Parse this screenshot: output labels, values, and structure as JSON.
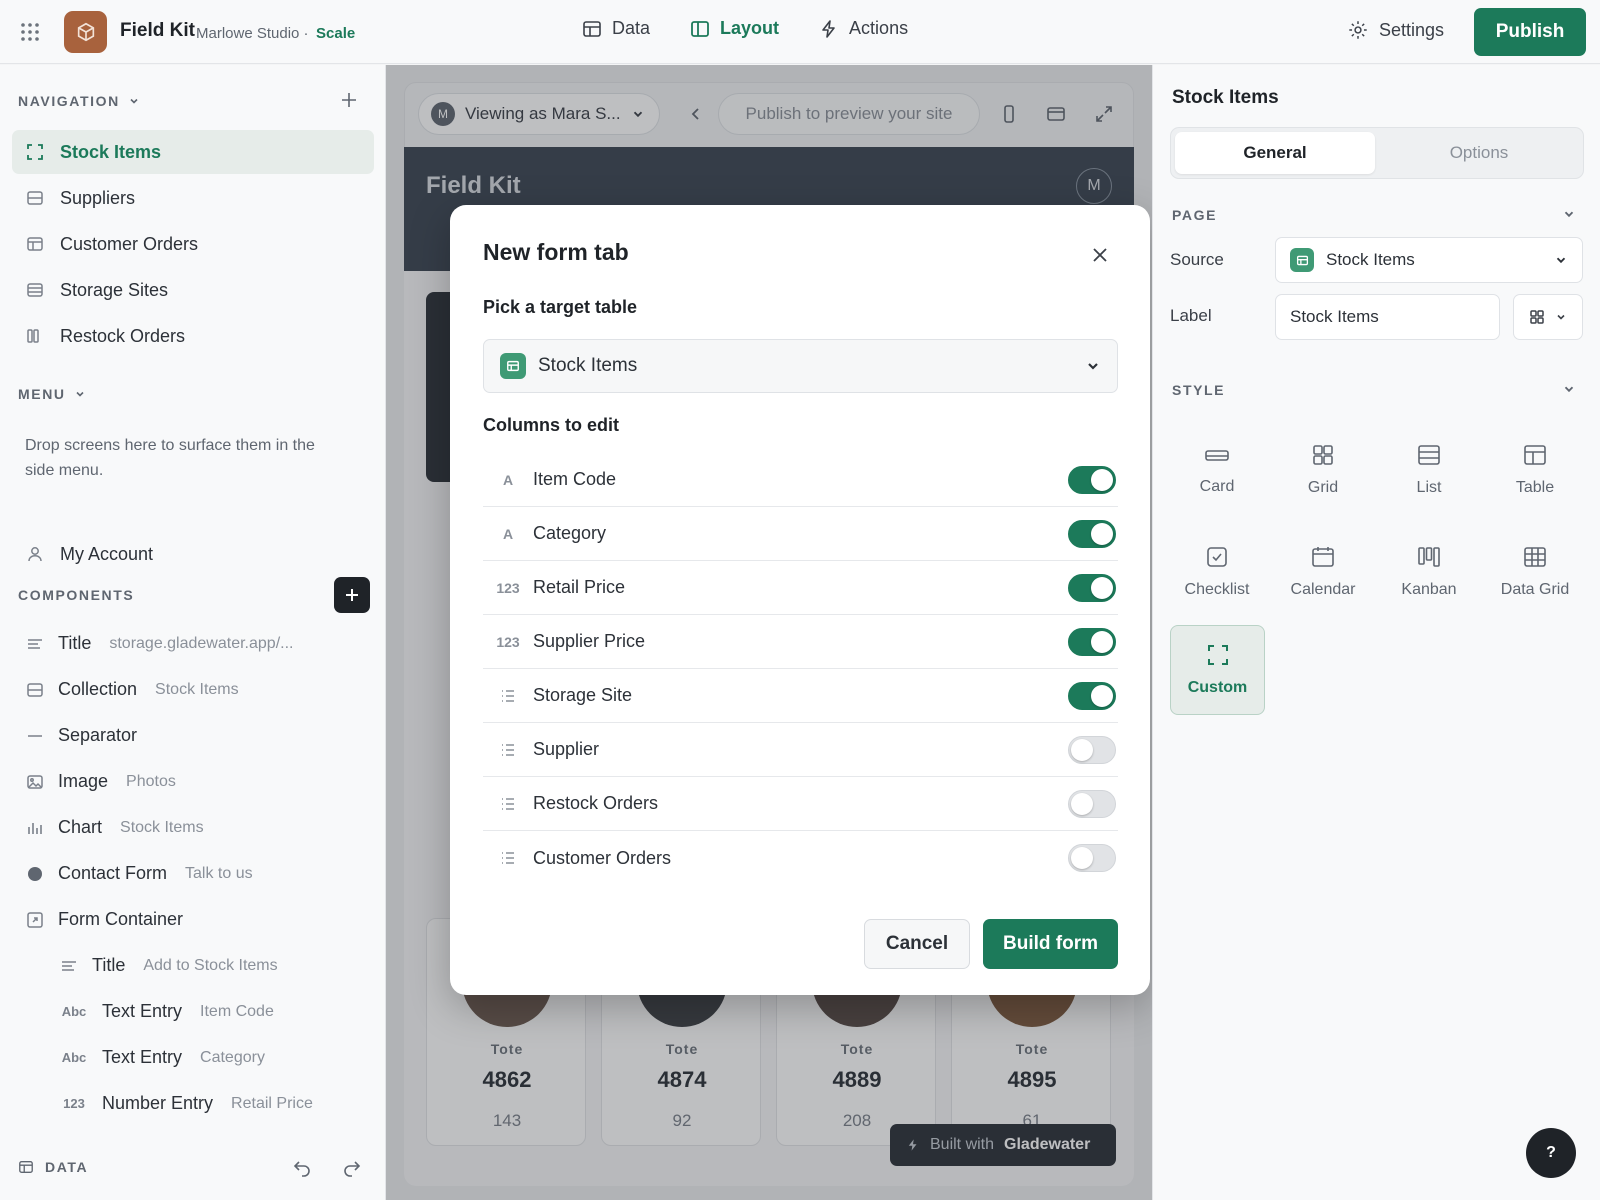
{
  "topbar": {
    "app_name": "Field Kit",
    "org_name": "Marlowe Studio ·",
    "plan": "Scale",
    "nav": [
      {
        "label": "Data",
        "icon": "table-icon"
      },
      {
        "label": "Layout",
        "icon": "layout-icon",
        "active": true
      },
      {
        "label": "Actions",
        "icon": "bolt-icon"
      }
    ],
    "settings_label": "Settings",
    "publish_label": "Publish"
  },
  "sidebar": {
    "navigation_heading": "NAVIGATION",
    "nav_items": [
      {
        "label": "Stock Items",
        "icon": "custom-screen-icon",
        "active": true
      },
      {
        "label": "Suppliers",
        "icon": "collection-icon"
      },
      {
        "label": "Customer Orders",
        "icon": "table-icon"
      },
      {
        "label": "Storage Sites",
        "icon": "list-icon"
      },
      {
        "label": "Restock Orders",
        "icon": "kanban-icon"
      }
    ],
    "menu_heading": "MENU",
    "menu_hint": "Drop screens here to surface them in the side menu.",
    "my_account": "My Account",
    "components_heading": "COMPONENTS",
    "components": [
      {
        "glyph": "",
        "label": "Title",
        "sub": "storage.gladewater.app/..."
      },
      {
        "glyph": "",
        "label": "Collection",
        "sub": "Stock Items"
      },
      {
        "glyph": "",
        "label": "Separator",
        "sub": ""
      },
      {
        "glyph": "",
        "label": "Image",
        "sub": "Photos"
      },
      {
        "glyph": "",
        "label": "Chart",
        "sub": "Stock Items"
      },
      {
        "glyph": "",
        "label": "Contact Form",
        "sub": "Talk to us"
      },
      {
        "glyph": "",
        "label": "Form Container",
        "sub": ""
      },
      {
        "glyph": "",
        "label": "Title",
        "sub": "Add to Stock Items"
      },
      {
        "glyph": "Abc",
        "label": "Text Entry",
        "sub": "Item Code"
      },
      {
        "glyph": "Abc",
        "label": "Text Entry",
        "sub": "Category"
      },
      {
        "glyph": "123",
        "label": "Number Entry",
        "sub": "Retail Price"
      }
    ],
    "footer_label": "DATA"
  },
  "preview": {
    "viewing_as": "Viewing as Mara S...",
    "viewer_initial": "M",
    "url_placeholder": "Publish to preview your site",
    "site_title": "Field Kit",
    "site_avatar": "M",
    "tiles": [
      {
        "label": "Tote",
        "number": "4862",
        "sub": "143"
      },
      {
        "label": "Tote",
        "number": "4874",
        "sub": "92"
      },
      {
        "label": "Tote",
        "number": "4889",
        "sub": "208"
      },
      {
        "label": "Tote",
        "number": "4895",
        "sub": "61"
      }
    ],
    "built_with_prefix": "Built with",
    "built_with_brand": "Gladewater"
  },
  "modal": {
    "title": "New form tab",
    "target_label": "Pick a target table",
    "target_value": "Stock Items",
    "columns_label": "Columns to edit",
    "columns": [
      {
        "type": "A",
        "name": "Item Code",
        "enabled": true
      },
      {
        "type": "A",
        "name": "Category",
        "enabled": true
      },
      {
        "type": "123",
        "name": "Retail Price",
        "enabled": true
      },
      {
        "type": "123",
        "name": "Supplier Price",
        "enabled": true
      },
      {
        "type": "list",
        "name": "Storage Site",
        "enabled": true
      },
      {
        "type": "list",
        "name": "Supplier",
        "enabled": false
      },
      {
        "type": "list",
        "name": "Restock Orders",
        "enabled": false
      },
      {
        "type": "list",
        "name": "Customer Orders",
        "enabled": false
      }
    ],
    "cancel_label": "Cancel",
    "build_label": "Build form"
  },
  "right": {
    "title": "Stock Items",
    "tabs": [
      {
        "label": "General",
        "active": true
      },
      {
        "label": "Options"
      }
    ],
    "page_heading": "PAGE",
    "source_label": "Source",
    "source_value": "Stock Items",
    "label_label": "Label",
    "label_value": "Stock Items",
    "style_heading": "STYLE",
    "styles": [
      {
        "label": "Card",
        "icon": "card-icon"
      },
      {
        "label": "Grid",
        "icon": "grid-icon"
      },
      {
        "label": "List",
        "icon": "list-icon"
      },
      {
        "label": "Table",
        "icon": "table-icon"
      },
      {
        "label": "Checklist",
        "icon": "checklist-icon"
      },
      {
        "label": "Calendar",
        "icon": "calendar-icon"
      },
      {
        "label": "Kanban",
        "icon": "kanban-icon"
      },
      {
        "label": "Data Grid",
        "icon": "data-grid-icon"
      },
      {
        "label": "Custom",
        "icon": "custom-screen-icon",
        "active": true
      }
    ],
    "help_label": "?"
  },
  "colors": {
    "accent": "#1c7a5a",
    "app_logo": "#a8623d",
    "site_header": "#3c4652"
  }
}
